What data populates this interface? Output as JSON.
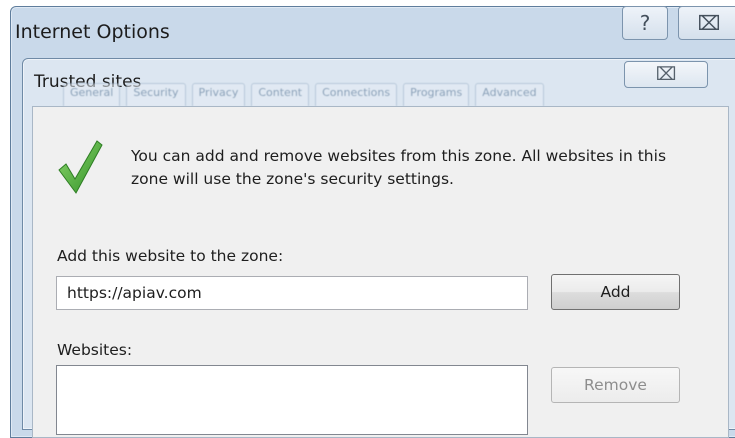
{
  "window": {
    "title": "Internet Options",
    "help_glyph": "?",
    "close_glyph": "⌧",
    "tabs": [
      "General",
      "Security",
      "Privacy",
      "Content",
      "Connections",
      "Programs",
      "Advanced"
    ]
  },
  "dialog": {
    "title": "Trusted sites",
    "close_glyph": "⌧",
    "description": "You can add and remove websites from this zone. All websites in this zone will use the zone's security settings.",
    "add_label": "Add this website to the zone:",
    "url_value": "https://apiav.com",
    "add_button": "Add",
    "websites_label": "Websites:",
    "remove_button": "Remove",
    "remove_enabled": false
  },
  "icons": {
    "check": "check-icon"
  },
  "colors": {
    "check_green": "#4caf3d",
    "frame": "#c9d9ea"
  }
}
